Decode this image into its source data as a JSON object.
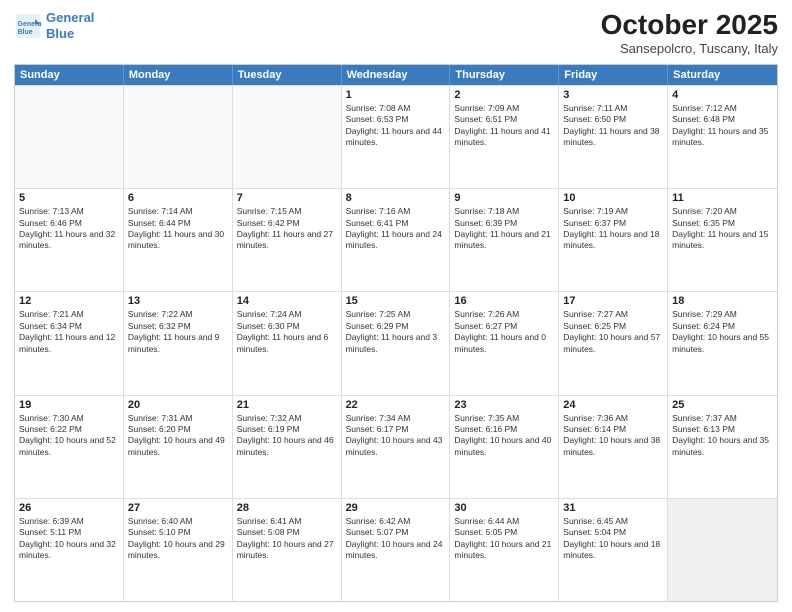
{
  "logo": {
    "line1": "General",
    "line2": "Blue"
  },
  "header": {
    "month": "October 2025",
    "location": "Sansepolcro, Tuscany, Italy"
  },
  "weekdays": [
    "Sunday",
    "Monday",
    "Tuesday",
    "Wednesday",
    "Thursday",
    "Friday",
    "Saturday"
  ],
  "rows": [
    [
      {
        "day": "",
        "text": "",
        "empty": true
      },
      {
        "day": "",
        "text": "",
        "empty": true
      },
      {
        "day": "",
        "text": "",
        "empty": true
      },
      {
        "day": "1",
        "text": "Sunrise: 7:08 AM\nSunset: 6:53 PM\nDaylight: 11 hours and 44 minutes."
      },
      {
        "day": "2",
        "text": "Sunrise: 7:09 AM\nSunset: 6:51 PM\nDaylight: 11 hours and 41 minutes."
      },
      {
        "day": "3",
        "text": "Sunrise: 7:11 AM\nSunset: 6:50 PM\nDaylight: 11 hours and 38 minutes."
      },
      {
        "day": "4",
        "text": "Sunrise: 7:12 AM\nSunset: 6:48 PM\nDaylight: 11 hours and 35 minutes."
      }
    ],
    [
      {
        "day": "5",
        "text": "Sunrise: 7:13 AM\nSunset: 6:46 PM\nDaylight: 11 hours and 32 minutes."
      },
      {
        "day": "6",
        "text": "Sunrise: 7:14 AM\nSunset: 6:44 PM\nDaylight: 11 hours and 30 minutes."
      },
      {
        "day": "7",
        "text": "Sunrise: 7:15 AM\nSunset: 6:42 PM\nDaylight: 11 hours and 27 minutes."
      },
      {
        "day": "8",
        "text": "Sunrise: 7:16 AM\nSunset: 6:41 PM\nDaylight: 11 hours and 24 minutes."
      },
      {
        "day": "9",
        "text": "Sunrise: 7:18 AM\nSunset: 6:39 PM\nDaylight: 11 hours and 21 minutes."
      },
      {
        "day": "10",
        "text": "Sunrise: 7:19 AM\nSunset: 6:37 PM\nDaylight: 11 hours and 18 minutes."
      },
      {
        "day": "11",
        "text": "Sunrise: 7:20 AM\nSunset: 6:35 PM\nDaylight: 11 hours and 15 minutes."
      }
    ],
    [
      {
        "day": "12",
        "text": "Sunrise: 7:21 AM\nSunset: 6:34 PM\nDaylight: 11 hours and 12 minutes."
      },
      {
        "day": "13",
        "text": "Sunrise: 7:22 AM\nSunset: 6:32 PM\nDaylight: 11 hours and 9 minutes."
      },
      {
        "day": "14",
        "text": "Sunrise: 7:24 AM\nSunset: 6:30 PM\nDaylight: 11 hours and 6 minutes."
      },
      {
        "day": "15",
        "text": "Sunrise: 7:25 AM\nSunset: 6:29 PM\nDaylight: 11 hours and 3 minutes."
      },
      {
        "day": "16",
        "text": "Sunrise: 7:26 AM\nSunset: 6:27 PM\nDaylight: 11 hours and 0 minutes."
      },
      {
        "day": "17",
        "text": "Sunrise: 7:27 AM\nSunset: 6:25 PM\nDaylight: 10 hours and 57 minutes."
      },
      {
        "day": "18",
        "text": "Sunrise: 7:29 AM\nSunset: 6:24 PM\nDaylight: 10 hours and 55 minutes."
      }
    ],
    [
      {
        "day": "19",
        "text": "Sunrise: 7:30 AM\nSunset: 6:22 PM\nDaylight: 10 hours and 52 minutes."
      },
      {
        "day": "20",
        "text": "Sunrise: 7:31 AM\nSunset: 6:20 PM\nDaylight: 10 hours and 49 minutes."
      },
      {
        "day": "21",
        "text": "Sunrise: 7:32 AM\nSunset: 6:19 PM\nDaylight: 10 hours and 46 minutes."
      },
      {
        "day": "22",
        "text": "Sunrise: 7:34 AM\nSunset: 6:17 PM\nDaylight: 10 hours and 43 minutes."
      },
      {
        "day": "23",
        "text": "Sunrise: 7:35 AM\nSunset: 6:16 PM\nDaylight: 10 hours and 40 minutes."
      },
      {
        "day": "24",
        "text": "Sunrise: 7:36 AM\nSunset: 6:14 PM\nDaylight: 10 hours and 38 minutes."
      },
      {
        "day": "25",
        "text": "Sunrise: 7:37 AM\nSunset: 6:13 PM\nDaylight: 10 hours and 35 minutes."
      }
    ],
    [
      {
        "day": "26",
        "text": "Sunrise: 6:39 AM\nSunset: 5:11 PM\nDaylight: 10 hours and 32 minutes."
      },
      {
        "day": "27",
        "text": "Sunrise: 6:40 AM\nSunset: 5:10 PM\nDaylight: 10 hours and 29 minutes."
      },
      {
        "day": "28",
        "text": "Sunrise: 6:41 AM\nSunset: 5:08 PM\nDaylight: 10 hours and 27 minutes."
      },
      {
        "day": "29",
        "text": "Sunrise: 6:42 AM\nSunset: 5:07 PM\nDaylight: 10 hours and 24 minutes."
      },
      {
        "day": "30",
        "text": "Sunrise: 6:44 AM\nSunset: 5:05 PM\nDaylight: 10 hours and 21 minutes."
      },
      {
        "day": "31",
        "text": "Sunrise: 6:45 AM\nSunset: 5:04 PM\nDaylight: 10 hours and 18 minutes."
      },
      {
        "day": "",
        "text": "",
        "empty": true,
        "shaded": true
      }
    ]
  ]
}
